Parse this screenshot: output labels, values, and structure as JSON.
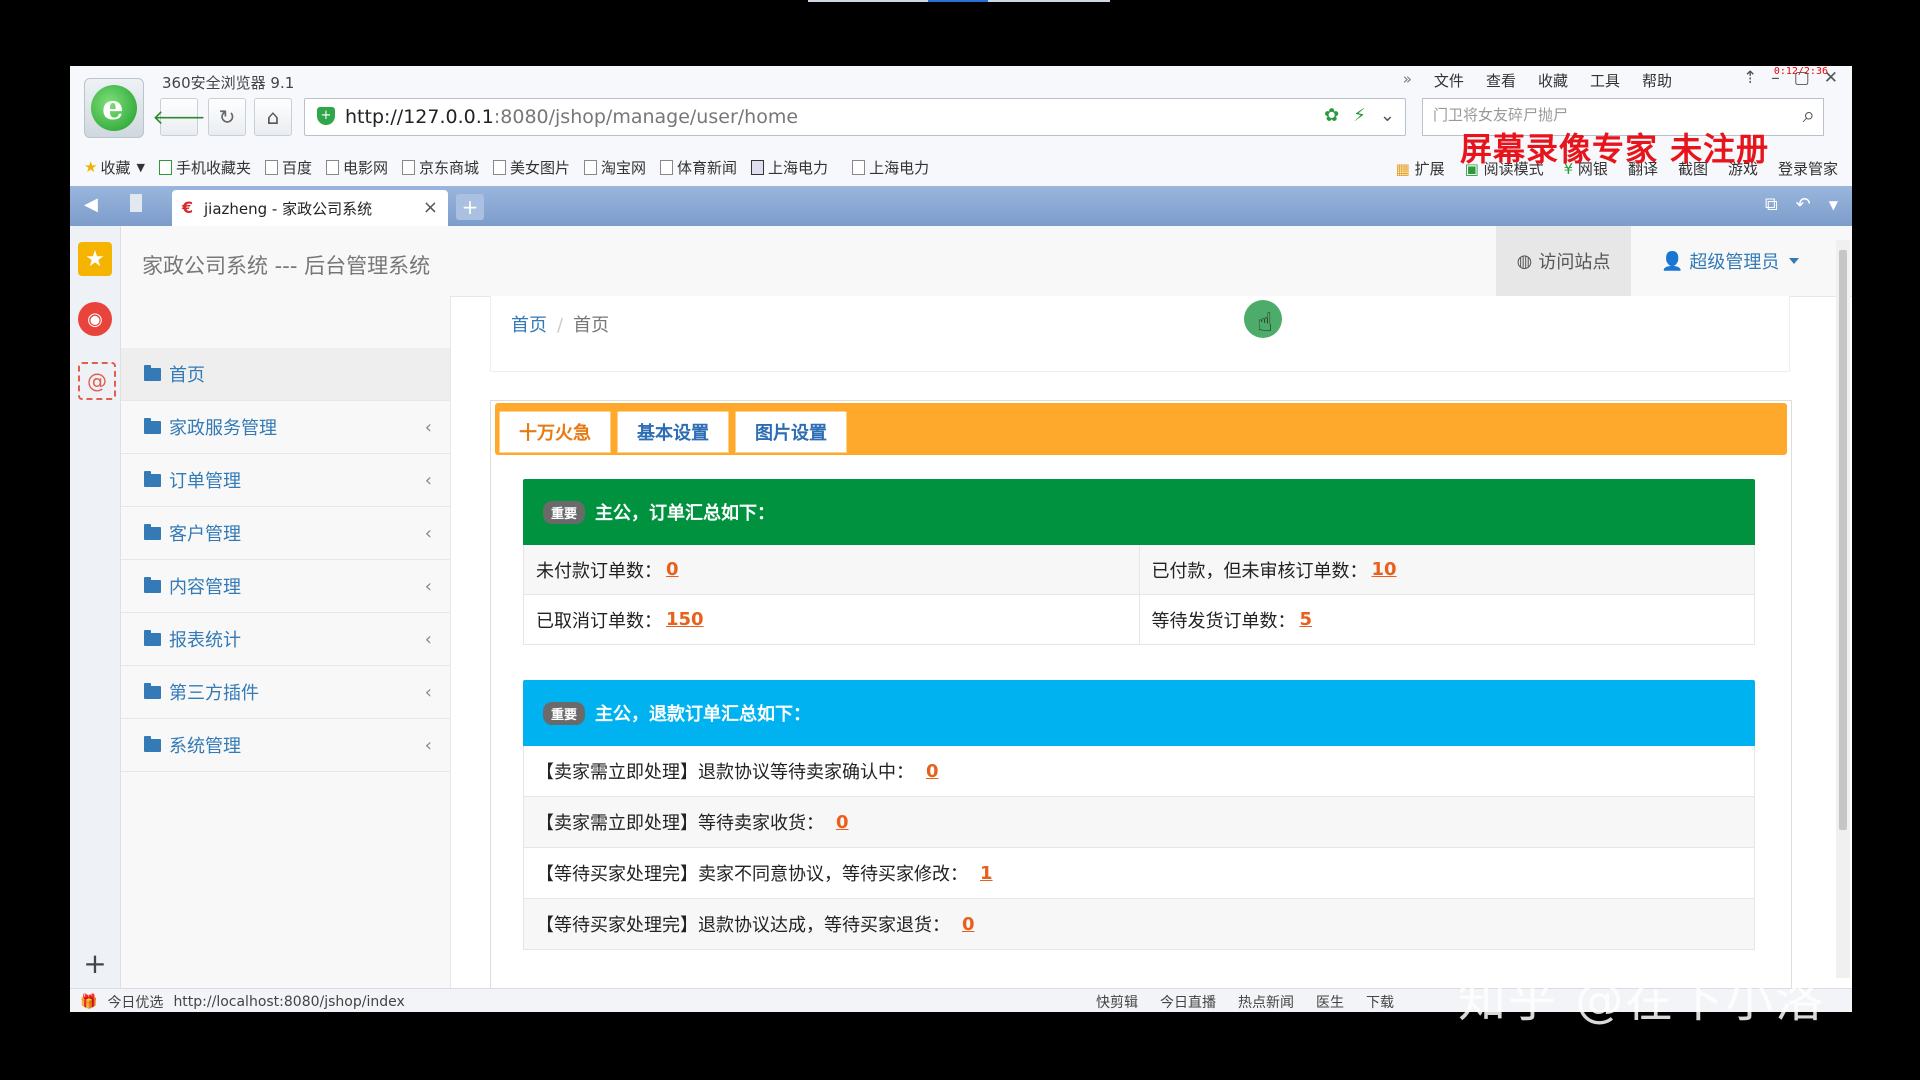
{
  "browser": {
    "app_title": "360安全浏览器 9.1",
    "top_menu": [
      "文件",
      "查看",
      "收藏",
      "工具",
      "帮助"
    ],
    "recording_timer": "0:12/2:36",
    "url_host": "http://127.0.0.1",
    "url_rest": ":8080/jshop/manage/user/home",
    "search_placeholder": "门卫将女友碎尸抛尸",
    "bookmarks": [
      "收藏",
      "手机收藏夹",
      "百度",
      "电影网",
      "京东商城",
      "美女图片",
      "淘宝网",
      "体育新闻",
      "上海电力",
      "上海电力"
    ],
    "bookmarks_right": [
      "扩展",
      "阅读模式",
      "网银",
      "翻译",
      "截图",
      "游戏",
      "登录管家"
    ],
    "recorder_watermark": "屏幕录像专家 未注册",
    "tab_title": "jiazheng - 家政公司系统",
    "status_left_label": "今日优选",
    "status_url": "http://localhost:8080/jshop/index",
    "status_right": [
      "快剪辑",
      "今日直播",
      "热点新闻",
      "医生",
      "下载"
    ],
    "watermark": "知乎 @在下小洛"
  },
  "header": {
    "brand": "家政公司系统 --- 后台管理系统",
    "visit_site": "访问站点",
    "admin": "超级管理员"
  },
  "sidebar": {
    "items": [
      {
        "label": "首页"
      },
      {
        "label": "家政服务管理"
      },
      {
        "label": "订单管理"
      },
      {
        "label": "客户管理"
      },
      {
        "label": "内容管理"
      },
      {
        "label": "报表统计"
      },
      {
        "label": "第三方插件"
      },
      {
        "label": "系统管理"
      }
    ]
  },
  "breadcrumb": {
    "home": "首页",
    "current": "首页"
  },
  "tabs": [
    "十万火急",
    "基本设置",
    "图片设置"
  ],
  "orders_box": {
    "badge": "重要",
    "title": "主公，订单汇总如下：",
    "rows": [
      [
        {
          "label": "未付款订单数：",
          "value": "0"
        },
        {
          "label": "已付款，但未审核订单数：",
          "value": "10"
        }
      ],
      [
        {
          "label": "已取消订单数：",
          "value": "150"
        },
        {
          "label": "等待发货订单数：",
          "value": "5"
        }
      ]
    ]
  },
  "refund_box": {
    "badge": "重要",
    "title": "主公，退款订单汇总如下：",
    "rows": [
      {
        "label": "【卖家需立即处理】退款协议等待卖家确认中：",
        "value": "0"
      },
      {
        "label": "【卖家需立即处理】等待卖家收货：",
        "value": "0"
      },
      {
        "label": "【等待买家处理完】卖家不同意协议，等待买家修改：",
        "value": "1"
      },
      {
        "label": "【等待买家处理完】退款协议达成，等待买家退货：",
        "value": "0"
      }
    ]
  }
}
